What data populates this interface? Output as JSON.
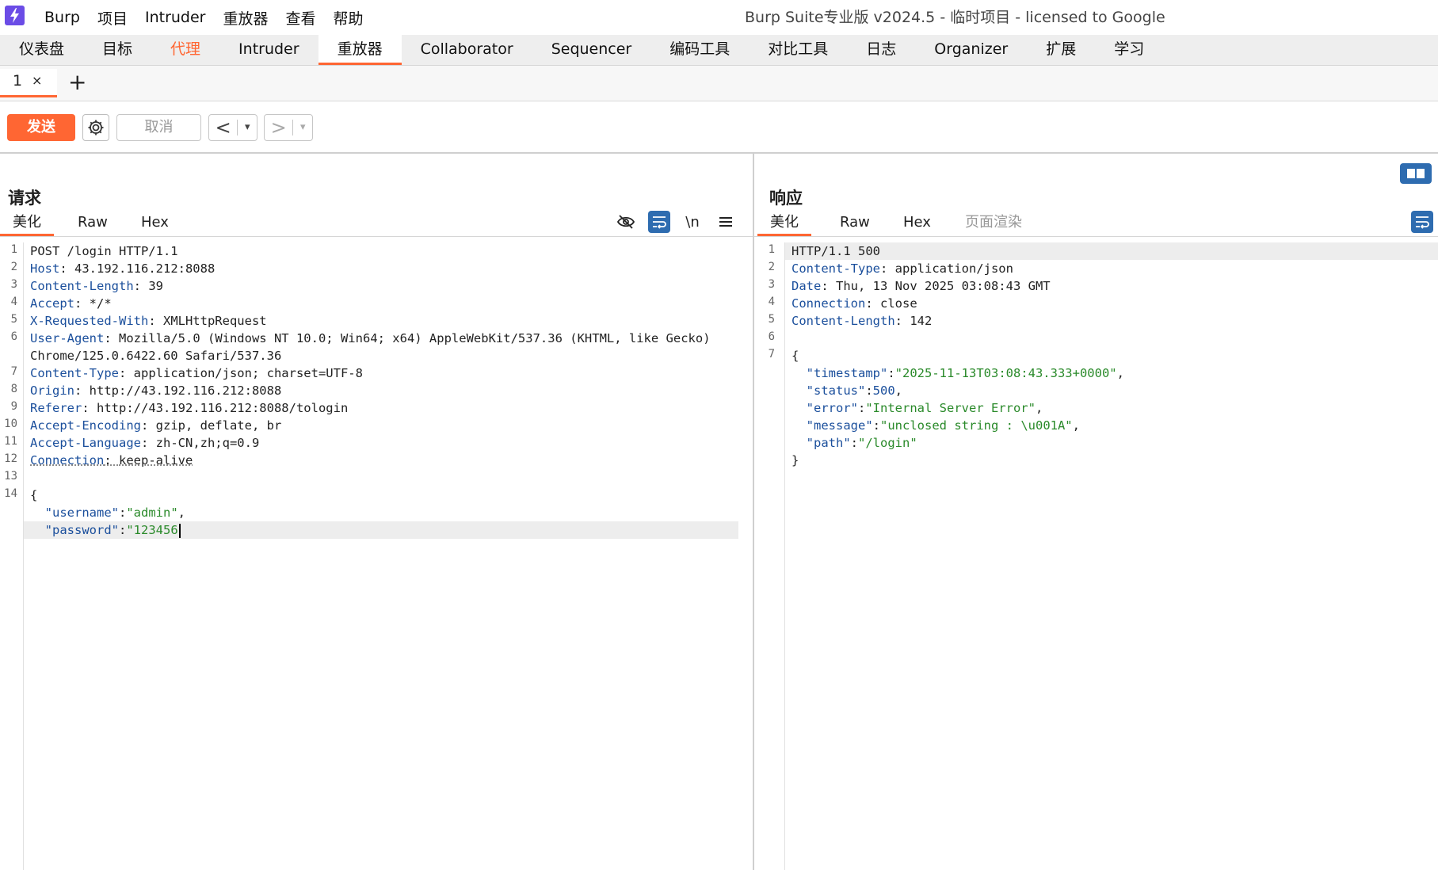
{
  "app": {
    "menu": [
      "Burp",
      "项目",
      "Intruder",
      "重放器",
      "查看",
      "帮助"
    ],
    "window_title": "Burp Suite专业版  v2024.5 - 临时项目 - licensed to Google"
  },
  "tool_tabs": [
    "仪表盘",
    "目标",
    "代理",
    "Intruder",
    "重放器",
    "Collaborator",
    "Sequencer",
    "编码工具",
    "对比工具",
    "日志",
    "Organizer",
    "扩展",
    "学习"
  ],
  "repeater": {
    "tab_label": "1",
    "tab_close": "×",
    "add_tab": "+",
    "toolbar": {
      "send": "发送",
      "cancel": "取消",
      "back": "<",
      "forward": ">",
      "dropdown": "▾"
    }
  },
  "request": {
    "title": "请求",
    "tabs": [
      "美化",
      "Raw",
      "Hex"
    ],
    "newline_icon_label": "\\n",
    "line_numbers": [
      "1",
      "2",
      "3",
      "4",
      "5",
      "6",
      "7",
      "8",
      "9",
      "10",
      "11",
      "12",
      "13",
      "14"
    ],
    "request_line": "POST /login HTTP/1.1",
    "headers": [
      {
        "name": "Host",
        "value": "43.192.116.212:8088"
      },
      {
        "name": "Content-Length",
        "value": "39"
      },
      {
        "name": "Accept",
        "value": "*/*"
      },
      {
        "name": "X-Requested-With",
        "value": "XMLHttpRequest"
      },
      {
        "name": "User-Agent",
        "value": "Mozilla/5.0 (Windows NT 10.0; Win64; x64) AppleWebKit/537.36 (KHTML, like Gecko)"
      },
      {
        "name": "Content-Type",
        "value": "application/json; charset=UTF-8"
      },
      {
        "name": "Origin",
        "value": "http://43.192.116.212:8088"
      },
      {
        "name": "Referer",
        "value": "http://43.192.116.212:8088/tologin"
      },
      {
        "name": "Accept-Encoding",
        "value": "gzip, deflate, br"
      },
      {
        "name": "Accept-Language",
        "value": "zh-CN,zh;q=0.9"
      },
      {
        "name": "Connection",
        "value": "keep-alive"
      }
    ],
    "user_agent_wrap": "Chrome/125.0.6422.60 Safari/537.36",
    "body": {
      "open": "{",
      "fields": [
        {
          "key": "\"username\"",
          "value": "\"admin\"",
          "trail": ","
        },
        {
          "key": "\"password\"",
          "value": "\"123456",
          "trail": ""
        }
      ]
    }
  },
  "response": {
    "title": "响应",
    "tabs": [
      "美化",
      "Raw",
      "Hex",
      "页面渲染"
    ],
    "line_numbers": [
      "1",
      "2",
      "3",
      "4",
      "5",
      "6",
      "7"
    ],
    "status_line": "HTTP/1.1 500",
    "headers": [
      {
        "name": "Content-Type",
        "value": "application/json"
      },
      {
        "name": "Date",
        "value": "Thu, 13 Nov 2025 03:08:43 GMT"
      },
      {
        "name": "Connection",
        "value": "close"
      },
      {
        "name": "Content-Length",
        "value": "142"
      }
    ],
    "body": {
      "open": "{",
      "fields": [
        {
          "key": "\"timestamp\"",
          "value": "\"2025-11-13T03:08:43.333+0000\"",
          "trail": ","
        },
        {
          "key": "\"status\"",
          "value": "500",
          "trail": ","
        },
        {
          "key": "\"error\"",
          "value": "\"Internal Server Error\"",
          "trail": ","
        },
        {
          "key": "\"message\"",
          "value": "\"unclosed string : \\u001A\"",
          "trail": ","
        },
        {
          "key": "\"path\"",
          "value": "\"/login\"",
          "trail": ""
        }
      ],
      "close": "}"
    }
  },
  "colors": {
    "accent": "#ff6633",
    "header_key": "#1b4f9c",
    "json_string": "#2a8a2a",
    "icon_blue": "#2e6cb0"
  }
}
